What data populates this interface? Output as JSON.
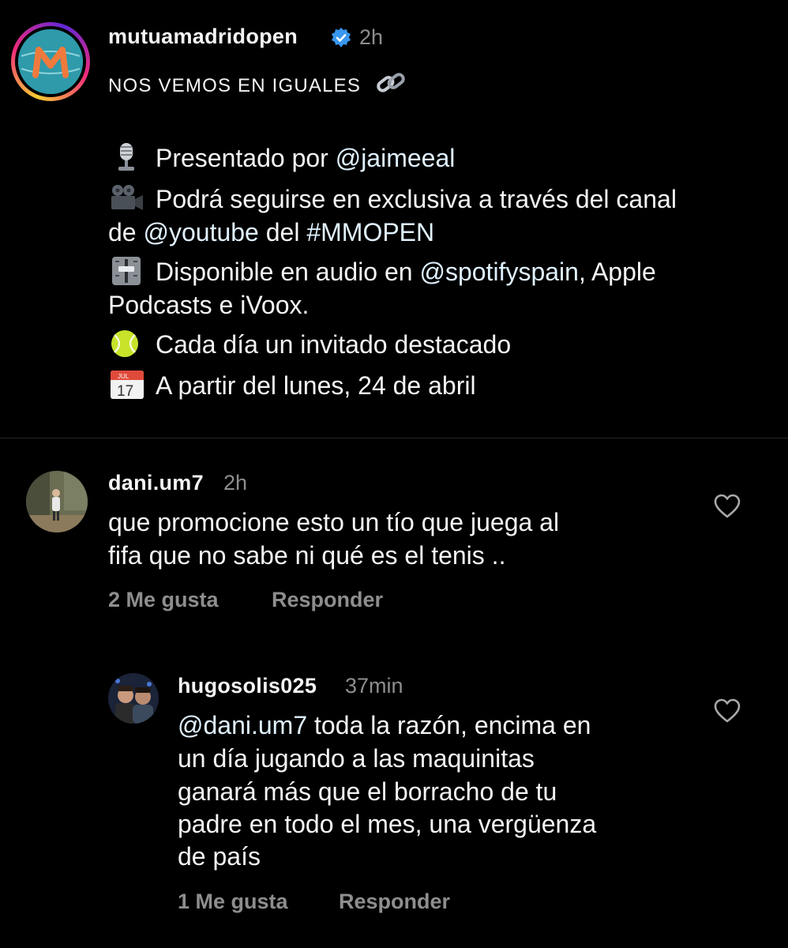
{
  "post": {
    "username": "mutuamadridopen",
    "time": "2h",
    "headline": "NOS VEMOS EN IGUALES",
    "lines": [
      {
        "icon": "microphone-icon",
        "text": "Presentado por ",
        "mention": "@jaimeeal"
      },
      {
        "icon": "movie-camera-icon",
        "text_a": "Podrá seguirse en exclusiva a través del canal",
        "text_b_prefix": "de ",
        "mention": "@youtube",
        "text_b_mid": " del ",
        "hashtag": "#MMOPEN"
      },
      {
        "icon": "level-slider-icon",
        "text_a_prefix": "Disponible en audio en ",
        "mention": "@spotifyspain",
        "text_a_suffix": ", Apple",
        "text_b": "Podcasts e iVoox."
      },
      {
        "icon": "tennis-ball-icon",
        "text": "Cada día un invitado destacado"
      },
      {
        "icon": "calendar-icon",
        "text": "A partir del lunes, 24 de abril",
        "calendar_month": "JUL",
        "calendar_day": "17"
      }
    ]
  },
  "comments": [
    {
      "username": "dani.um7",
      "time": "2h",
      "line1": "que promocione esto un tío que juega al",
      "line2": "fifa que no sabe ni qué es el tenis ..",
      "likes_label": "2 Me gusta",
      "reply_label": "Responder"
    },
    {
      "username": "hugosolis025",
      "time": "37min",
      "mention": "@dani.um7",
      "line1_rest": " toda la razón, encima en",
      "line2": "un día jugando a las maquinitas",
      "line3": "ganará más que el borracho de tu",
      "line4": "padre en todo el mes, una vergüenza",
      "line5": "de país",
      "likes_label": "1 Me gusta",
      "reply_label": "Responder"
    }
  ],
  "colors": {
    "background": "#000000",
    "text": "#f5f5f5",
    "secondary": "#8e8e8e",
    "verified": "#3897f0",
    "brand": "#2e9aaa"
  }
}
